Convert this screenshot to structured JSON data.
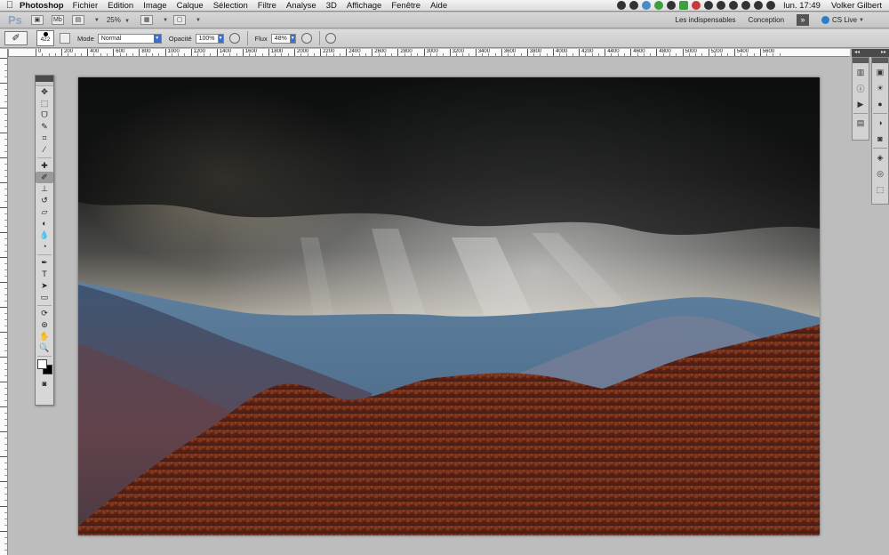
{
  "menubar": {
    "app_name": "Photoshop",
    "items": [
      "Fichier",
      "Edition",
      "Image",
      "Calque",
      "Sélection",
      "Filtre",
      "Analyse",
      "3D",
      "Affichage",
      "Fenêtre",
      "Aide"
    ],
    "clock": "lun. 17:49",
    "user": "Volker Gilbert"
  },
  "appbar": {
    "logo": "Ps",
    "zoom": "25%",
    "workspaces": [
      "Les indispensables",
      "Conception"
    ],
    "more": "»",
    "cs_live": "CS Live"
  },
  "options": {
    "brush_size": "422",
    "mode_label": "Mode",
    "mode_value": "Normal",
    "opacity_label": "Opacité",
    "opacity_value": "100%",
    "flow_label": "Flux",
    "flow_value": "48%"
  },
  "ruler": {
    "labels": [
      "0",
      "200",
      "400",
      "600",
      "800",
      "1000",
      "1200",
      "1400",
      "1600",
      "1800",
      "2000",
      "2200",
      "2400",
      "2600",
      "2800",
      "3000",
      "3200",
      "3400",
      "3600",
      "3800",
      "4000",
      "4200",
      "4400",
      "4600",
      "4800",
      "5000",
      "5200",
      "5400",
      "5600"
    ]
  },
  "colors": {
    "foreground": "#ffffff",
    "background": "#000000",
    "accent": "#3a6fd0"
  },
  "tools": [
    {
      "name": "move-tool-icon",
      "glyph": "✥"
    },
    {
      "name": "marquee-tool-icon",
      "glyph": "⬚"
    },
    {
      "name": "lasso-tool-icon",
      "glyph": "ᗜ"
    },
    {
      "name": "quick-select-tool-icon",
      "glyph": "✎"
    },
    {
      "name": "crop-tool-icon",
      "glyph": "⌗"
    },
    {
      "name": "eyedropper-tool-icon",
      "glyph": "⁄"
    },
    {
      "name": "healing-brush-tool-icon",
      "glyph": "✚"
    },
    {
      "name": "brush-tool-icon",
      "glyph": "✐"
    },
    {
      "name": "stamp-tool-icon",
      "glyph": "⊥"
    },
    {
      "name": "history-brush-tool-icon",
      "glyph": "↺"
    },
    {
      "name": "eraser-tool-icon",
      "glyph": "▱"
    },
    {
      "name": "gradient-tool-icon",
      "glyph": "◐"
    },
    {
      "name": "blur-tool-icon",
      "glyph": "💧"
    },
    {
      "name": "dodge-tool-icon",
      "glyph": "◔"
    },
    {
      "name": "pen-tool-icon",
      "glyph": "✒"
    },
    {
      "name": "type-tool-icon",
      "glyph": "T"
    },
    {
      "name": "path-select-tool-icon",
      "glyph": "➤"
    },
    {
      "name": "shape-tool-icon",
      "glyph": "▭"
    },
    {
      "name": "3d-rotate-tool-icon",
      "glyph": "⟳"
    },
    {
      "name": "3d-orbit-tool-icon",
      "glyph": "⊚"
    },
    {
      "name": "hand-tool-icon",
      "glyph": "✋"
    },
    {
      "name": "zoom-tool-icon",
      "glyph": "🔍"
    }
  ],
  "right_panels": {
    "group1": [
      "histogram-icon",
      "info-icon",
      "actions-icon",
      "layer-comps-icon"
    ],
    "group2": [
      "image-icon",
      "adjustments-icon",
      "styles-icon",
      "mask-icon",
      "channels-icon",
      "layers-icon",
      "paths-icon",
      "transform-icon"
    ]
  }
}
